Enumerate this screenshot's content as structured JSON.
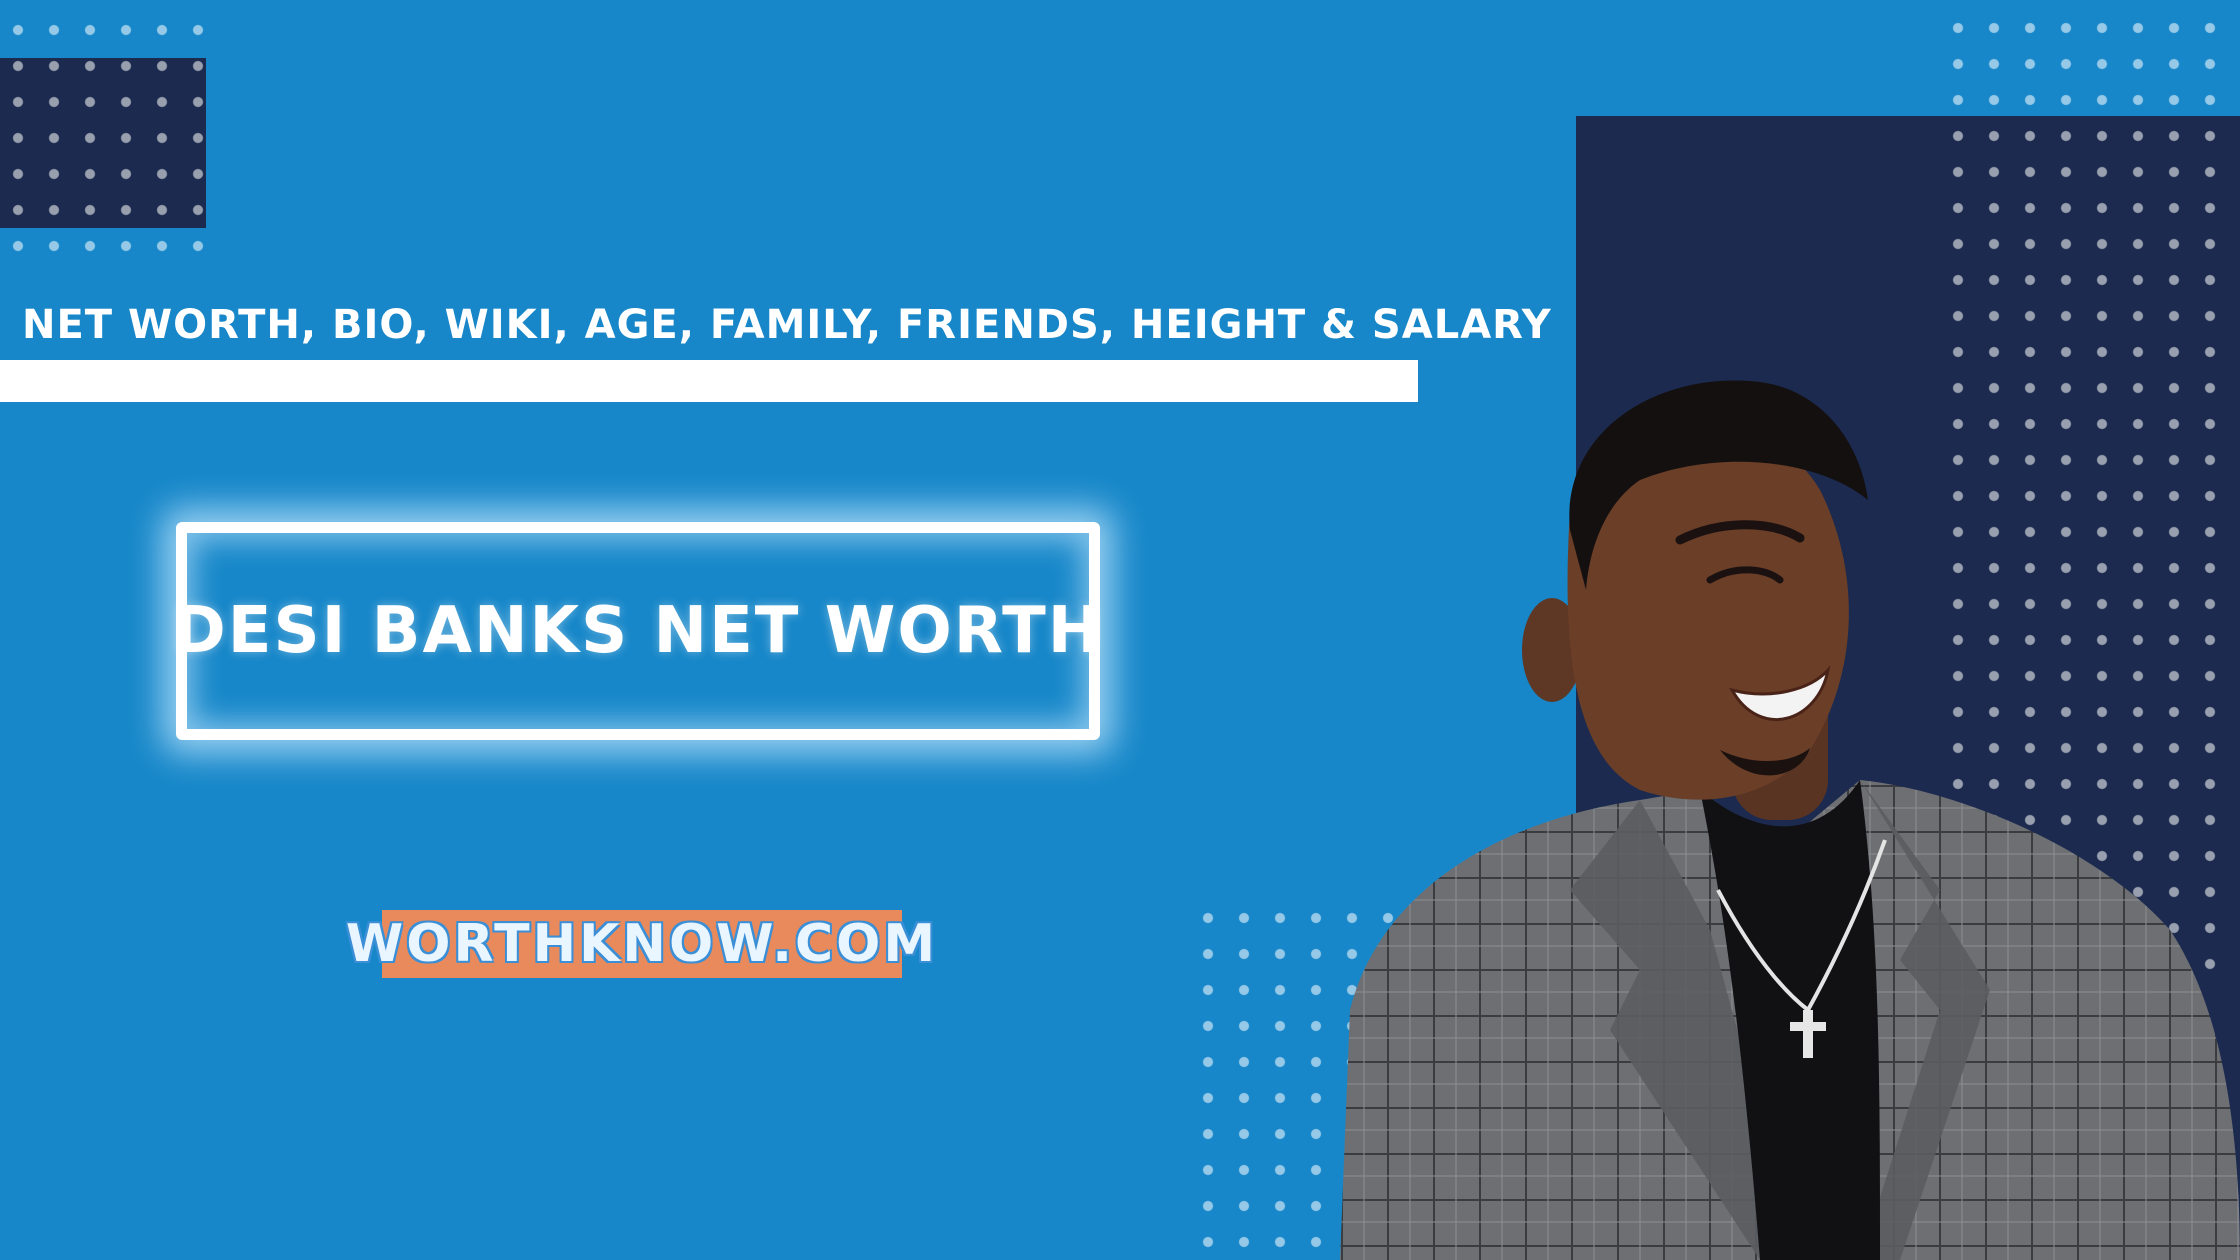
{
  "header": {
    "subtitle": "NET WORTH, BIO, WIKI, AGE, FAMILY, FRIENDS, HEIGHT & SALARY"
  },
  "main": {
    "title": "DESI BANKS NET WORTH",
    "site": "WORTHKNOW.COM"
  },
  "colors": {
    "background": "#1787c9",
    "navy": "#1b2a4e",
    "badge": "#e88a5b",
    "white": "#ffffff"
  },
  "icons": [
    "cross-pendant-icon"
  ]
}
